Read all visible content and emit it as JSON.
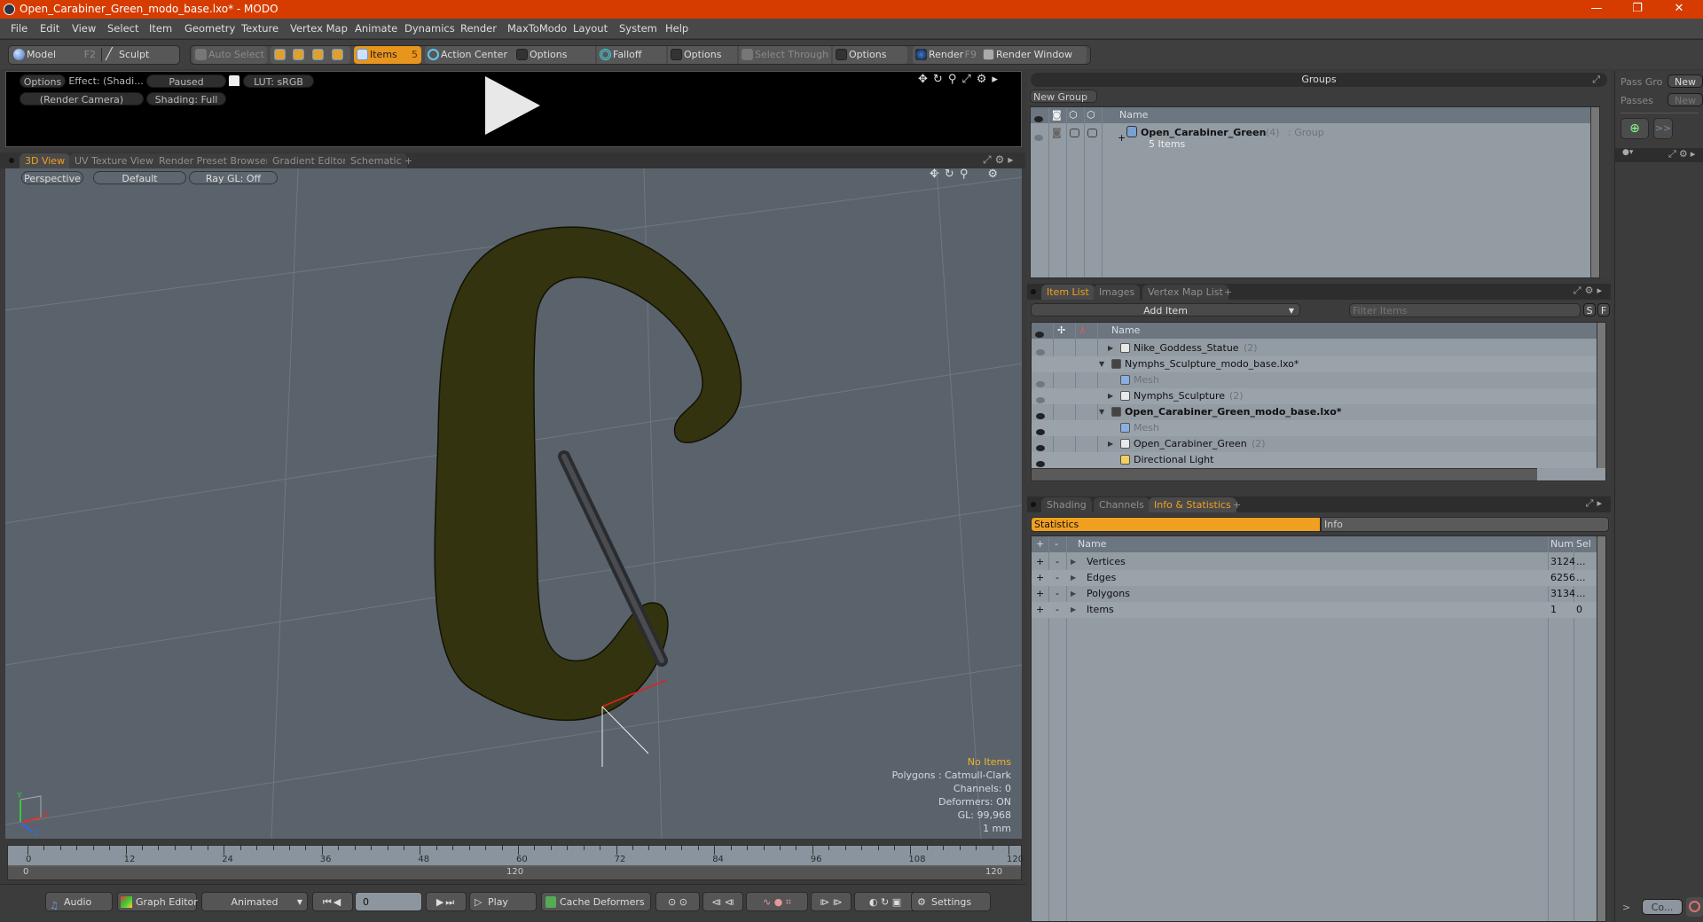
{
  "window": {
    "title": "Open_Carabiner_Green_modo_base.lxo* - MODO",
    "controls": {
      "minimize": "—",
      "restore": "❐",
      "close": "✕"
    }
  },
  "menu": [
    "File",
    "Edit",
    "View",
    "Select",
    "Item",
    "Geometry",
    "Texture",
    "Vertex Map",
    "Animate",
    "Dynamics",
    "Render",
    "MaxToModo",
    "Layout",
    "System",
    "Help"
  ],
  "toolbar": {
    "model": "Model",
    "model_key": "F2",
    "sculpt": "Sculpt",
    "auto_select": "Auto Select",
    "items": "Items",
    "items_count": "5",
    "action_center": "Action Center",
    "options1": "Options",
    "falloff": "Falloff",
    "options2": "Options",
    "select_through": "Select Through",
    "options3": "Options",
    "render": "Render",
    "render_key": "F9",
    "render_window": "Render Window"
  },
  "preview": {
    "options": "Options",
    "effect": "Effect: (Shadi...",
    "paused": "Paused",
    "lut": "LUT: sRGB",
    "camera": "(Render Camera)",
    "shading": "Shading: Full"
  },
  "viewport_tabs": [
    "3D View",
    "UV Texture View",
    "Render Preset Browser",
    "Gradient Editor",
    "Schematic",
    "+"
  ],
  "viewport": {
    "projection": "Perspective",
    "style": "Default",
    "raygl": "Ray GL: Off",
    "hud": {
      "selection": "No Items",
      "polygons": "Polygons : Catmull-Clark",
      "channels": "Channels: 0",
      "deformers": "Deformers: ON",
      "gl": "GL: 99,968",
      "unit": "1 mm"
    },
    "axes": {
      "x": "X",
      "y": "Y",
      "z": "Z"
    }
  },
  "timeline": {
    "ticks": [
      "0",
      "12",
      "24",
      "36",
      "48",
      "60",
      "72",
      "84",
      "96",
      "108",
      "120"
    ],
    "range_start": "0",
    "range_mid": "120",
    "range_end": "120"
  },
  "transport": {
    "audio": "Audio",
    "graph_editor": "Graph Editor",
    "mode": "Animated",
    "frame": "0",
    "play": "Play",
    "cache_deformers": "Cache Deformers",
    "settings": "Settings"
  },
  "groups": {
    "title": "Groups",
    "new_group": "New Group",
    "col_name": "Name",
    "rows": [
      {
        "name": "Open_Carabiner_Green",
        "count": "(4)",
        "type": ": Group",
        "sub": "5 Items"
      }
    ]
  },
  "passes": {
    "pass_groups": "Pass Gro",
    "new1": "New",
    "passes": "Passes",
    "new2": "New",
    "forward": ">>",
    "bottom_btn": "Co...",
    "bottom_arrow": ">"
  },
  "itemlist": {
    "tabs": [
      "Item List",
      "Images",
      "Vertex Map List",
      "+"
    ],
    "add_item": "Add Item",
    "filter_placeholder": "Filter Items",
    "s_btn": "S",
    "f_btn": "F",
    "col_name": "Name",
    "rows": [
      {
        "indent": 2,
        "expander": "▶",
        "icon": "group",
        "name": "Nike_Goddess_Statue",
        "count": "(2)",
        "eye": "dim",
        "bold": false,
        "gray": false
      },
      {
        "indent": 1,
        "expander": "▼",
        "icon": "scene",
        "name": "Nymphs_Sculpture_modo_base.lxo*",
        "count": "",
        "eye": "none",
        "bold": false,
        "gray": false
      },
      {
        "indent": 2,
        "expander": "",
        "icon": "mesh",
        "name": "Mesh",
        "count": "",
        "eye": "dim",
        "bold": false,
        "gray": true
      },
      {
        "indent": 2,
        "expander": "▶",
        "icon": "group",
        "name": "Nymphs_Sculpture",
        "count": "(2)",
        "eye": "dim",
        "bold": false,
        "gray": false
      },
      {
        "indent": 1,
        "expander": "▼",
        "icon": "scene",
        "name": "Open_Carabiner_Green_modo_base.lxo*",
        "count": "",
        "eye": "on",
        "bold": true,
        "gray": false
      },
      {
        "indent": 2,
        "expander": "",
        "icon": "mesh",
        "name": "Mesh",
        "count": "",
        "eye": "on",
        "bold": false,
        "gray": true
      },
      {
        "indent": 2,
        "expander": "▶",
        "icon": "group",
        "name": "Open_Carabiner_Green",
        "count": "(2)",
        "eye": "on",
        "bold": false,
        "gray": false
      },
      {
        "indent": 2,
        "expander": "",
        "icon": "light",
        "name": "Directional Light",
        "count": "",
        "eye": "on",
        "bold": false,
        "gray": false
      }
    ]
  },
  "stats": {
    "tabs": [
      "Shading",
      "Channels",
      "Info & Statistics",
      "+"
    ],
    "subtabs": [
      "Statistics",
      "Info"
    ],
    "cols": {
      "plus": "+",
      "minus": "-",
      "name": "Name",
      "num": "Num",
      "sel": "Sel"
    },
    "rows": [
      {
        "name": "Vertices",
        "num": "3124",
        "sel": "..."
      },
      {
        "name": "Edges",
        "num": "6256",
        "sel": "..."
      },
      {
        "name": "Polygons",
        "num": "3134",
        "sel": "..."
      },
      {
        "name": "Items",
        "num": "1",
        "sel": "0"
      }
    ]
  },
  "colors": {
    "accent": "#e8951e",
    "titlebar": "#d63c00",
    "viewport_bg": "#5a636b",
    "mesh": "#33340f"
  }
}
